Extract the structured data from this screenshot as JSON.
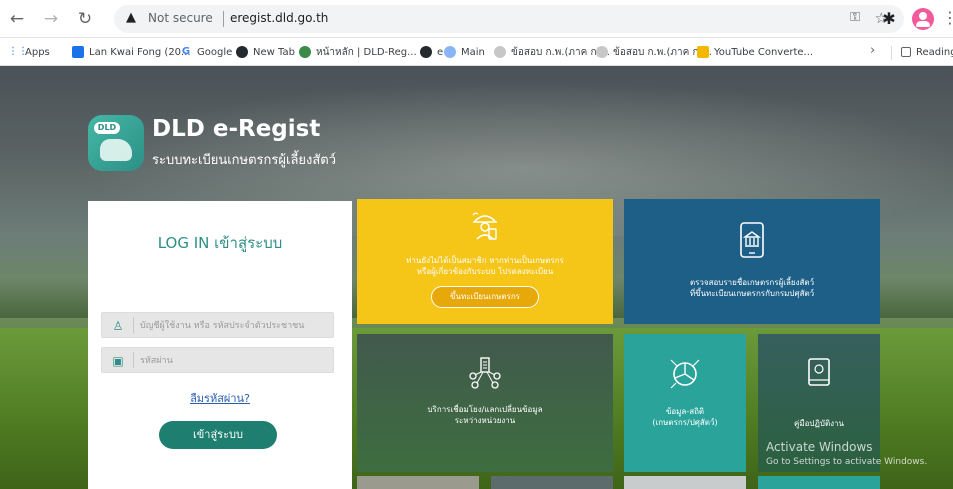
{
  "browser": {
    "not_secure": "Not secure",
    "url": "eregist.dld.go.th",
    "bookmarks": [
      {
        "label": "Apps",
        "icon": "apps-grid-icon"
      },
      {
        "label": "Lan Kwai Fong (20...",
        "icon": "bookmark-doc-icon"
      },
      {
        "label": "Google",
        "icon": "google-icon"
      },
      {
        "label": "New Tab",
        "icon": "github-icon"
      },
      {
        "label": "หน้าหลัก | DLD-Reg...",
        "icon": "dld-site-icon"
      },
      {
        "label": "e",
        "icon": "github-icon"
      },
      {
        "label": "Main",
        "icon": "globe-icon"
      },
      {
        "label": "ข้อสอบ ก.พ.(ภาค ก)...",
        "icon": "page-icon"
      },
      {
        "label": "ข้อสอบ ก.พ.(ภาค ก)...",
        "icon": "page-icon"
      },
      {
        "label": "YouTube Converte...",
        "icon": "converter-icon"
      }
    ],
    "reading_list": "Reading list"
  },
  "brand": {
    "logo_text": "DLD",
    "title": "DLD e-Regist",
    "subtitle": "ระบบทะเบียนเกษตรกรผู้เลี้ยงสัตว์"
  },
  "login": {
    "title": "LOG IN เข้าสู่ระบบ",
    "username_placeholder": "บัญชีผู้ใช้งาน หรือ รหัสประจำตัวประชาชน",
    "password_placeholder": "รหัสผ่าน",
    "forgot": "ลืมรหัสผ่าน?",
    "submit": "เข้าสู่ระบบ"
  },
  "tiles": {
    "register": {
      "line1": "ท่านยังไม่ได้เป็นสมาชิก หากท่านเป็นเกษตรกร",
      "line2": "หรือผู้เกี่ยวข้องกับระบบ โปรดลงทะเบียน",
      "button": "ขึ้นทะเบียนเกษตรกร"
    },
    "verify": {
      "line1": "ตรวจสอบรายชื่อเกษตรกรผู้เลี้ยงสัตว์",
      "line2": "ที่ขึ้นทะเบียนเกษตรกรกับกรมปศุสัตว์"
    },
    "exchange": {
      "line1": "บริการเชื่อมโยง/แลกเปลี่ยนข้อมูล",
      "line2": "ระหว่างหน่วยงาน"
    },
    "stats": {
      "line1": "ข้อมูล-สถิติ",
      "line2": "(เกษตรกร/ปศุสัตว์)"
    },
    "manual": {
      "line1": "คู่มือปฏิบัติงาน"
    }
  },
  "watermark": {
    "title": "Activate Windows",
    "sub": "Go to Settings to activate Windows."
  }
}
